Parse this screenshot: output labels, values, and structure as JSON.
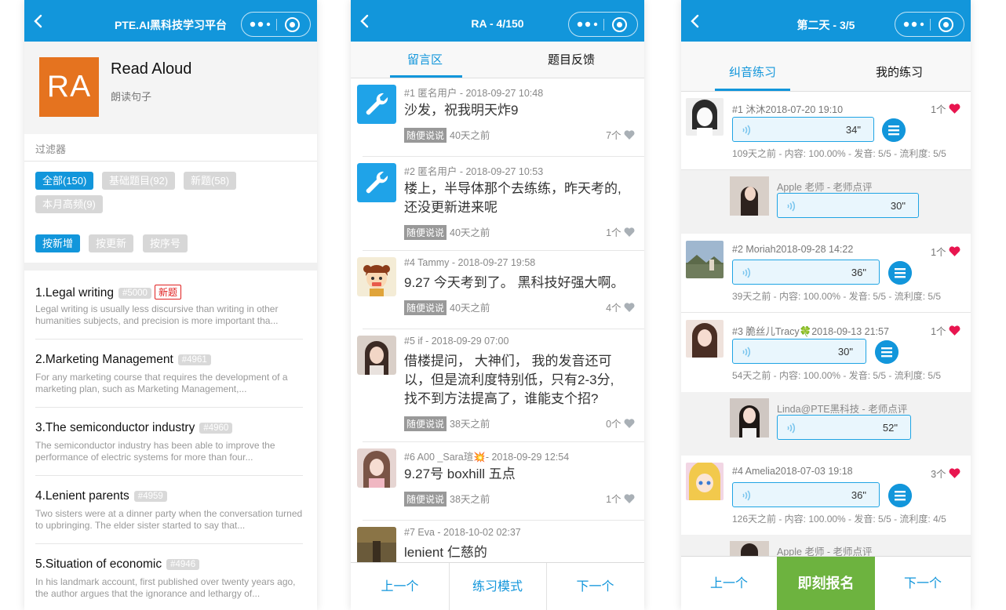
{
  "phone1": {
    "title": "PTE.AI黑科技学习平台",
    "header": {
      "logo_text": "RA",
      "title": "Read Aloud",
      "subtitle": "朗读句子"
    },
    "filter_label": "过滤器",
    "chips_row1": [
      "全部(150)",
      "基础题目(92)",
      "新题(58)"
    ],
    "chips_row2": [
      "本月高频(9)"
    ],
    "sort_chips": [
      "按新增",
      "按更新",
      "按序号"
    ],
    "articles": [
      {
        "title": "1.Legal writing",
        "num": "#5000",
        "badge": "新题",
        "desc": "Legal writing is usually less discursive than writing in other humanities subjects, and precision is more important tha..."
      },
      {
        "title": "2.Marketing Management",
        "num": "#4961",
        "badge": "",
        "desc": "For any marketing course that requires the development of a marketing plan, such as Marketing Management,..."
      },
      {
        "title": "3.The semiconductor industry",
        "num": "#4960",
        "badge": "",
        "desc": "The semiconductor industry has been able to improve the performance of electric systems for more than four..."
      },
      {
        "title": "4.Lenient parents",
        "num": "#4959",
        "badge": "",
        "desc": "Two sisters were at a dinner party when the conversation turned to upbringing. The elder sister started to say that..."
      },
      {
        "title": "5.Situation of economic",
        "num": "#4946",
        "badge": "",
        "desc": "In his landmark account, first published over twenty years ago, the author argues that the ignorance and lethargy of..."
      }
    ]
  },
  "phone2": {
    "title": "RA - 4/150",
    "tabs": [
      "留言区",
      "题目反馈"
    ],
    "comments": [
      {
        "meta": "#1 匿名用户 - 2018-09-27 10:48",
        "lines": [
          "沙发，祝我明天炸9"
        ],
        "tag": "随便说说",
        "ago": "40天之前",
        "likes": "7个"
      },
      {
        "meta": "#2 匿名用户 - 2018-09-27 10:53",
        "lines": [
          "楼上，半导体那个去练练，昨天考的,",
          "还没更新进来呢"
        ],
        "tag": "随便说说",
        "ago": "40天之前",
        "likes": "1个"
      },
      {
        "meta": "#4 Tammy - 2018-09-27 19:58",
        "lines": [
          "9.27 今天考到了。 黑科技好强大啊。"
        ],
        "tag": "随便说说",
        "ago": "40天之前",
        "likes": "4个"
      },
      {
        "meta": "#5 if - 2018-09-29 07:00",
        "lines": [
          "借楼提问， 大神们， 我的发音还可",
          "以，但是流利度特别低，只有2-3分,",
          "找不到方法提高了，谁能支个招?"
        ],
        "tag": "随便说说",
        "ago": "38天之前",
        "likes": "0个"
      },
      {
        "meta": "#6 A00 _Sara瑄💥- 2018-09-29 12:54",
        "lines": [
          "9.27号 boxhill 五点"
        ],
        "tag": "随便说说",
        "ago": "38天之前",
        "likes": "1个"
      },
      {
        "meta": "#7 Eva - 2018-10-02 02:37",
        "lines": [
          "lenient 仁慈的"
        ],
        "tag": "",
        "ago": "",
        "likes": ""
      }
    ],
    "bottom": [
      "上一个",
      "练习模式",
      "下一个"
    ]
  },
  "phone3": {
    "title": "第二天 - 3/5",
    "tabs": [
      "纠音练习",
      "我的练习"
    ],
    "records": [
      {
        "name": "#1 沐沐",
        "time": "2018-07-20 19:10",
        "likes": "1个",
        "seconds": "34\"",
        "stats": "109天之前 - 内容: 100.00% - 发音: 5/5 - 流利度: 5/5"
      },
      {
        "name": "#2 Moriah",
        "time": "2018-09-28 14:22",
        "likes": "1个",
        "seconds": "36\"",
        "stats": "39天之前 - 内容: 100.00% - 发音: 5/5 - 流利度: 5/5"
      },
      {
        "name": "#3 脆丝儿Tracy🍀",
        "time": "2018-09-13 21:57",
        "likes": "1个",
        "seconds": "30\"",
        "stats": "54天之前 - 内容: 100.00% - 发音: 5/5 - 流利度: 5/5"
      },
      {
        "name": "#4 Amelia",
        "time": "2018-07-03 19:18",
        "likes": "3个",
        "seconds": "36\"",
        "stats": "126天之前 - 内容: 100.00% - 发音: 5/5 - 流利度: 4/5"
      }
    ],
    "teacher_reviews": [
      {
        "name": "Apple 老师 - 老师点评",
        "seconds": "30\""
      },
      {
        "name": "Linda@PTE黑科技 - 老师点评",
        "seconds": "52\""
      },
      {
        "name": "Apple 老师 - 老师点评",
        "seconds": ""
      }
    ],
    "bottom": [
      "上一个",
      "即刻报名",
      "下一个"
    ]
  },
  "colors": {
    "primary": "#1296db",
    "orange_logo": "#e5731f",
    "heart": "#e8154f",
    "signup_green": "#6db33f",
    "new_badge": "#e02020"
  },
  "icons": {
    "back": "chevron-left-icon",
    "more": "more-dots-icon",
    "record": "record-target-icon",
    "wrench": "wrench-icon",
    "heart": "heart-icon",
    "wave": "sound-wave-icon",
    "menu": "menu-lines-icon"
  }
}
